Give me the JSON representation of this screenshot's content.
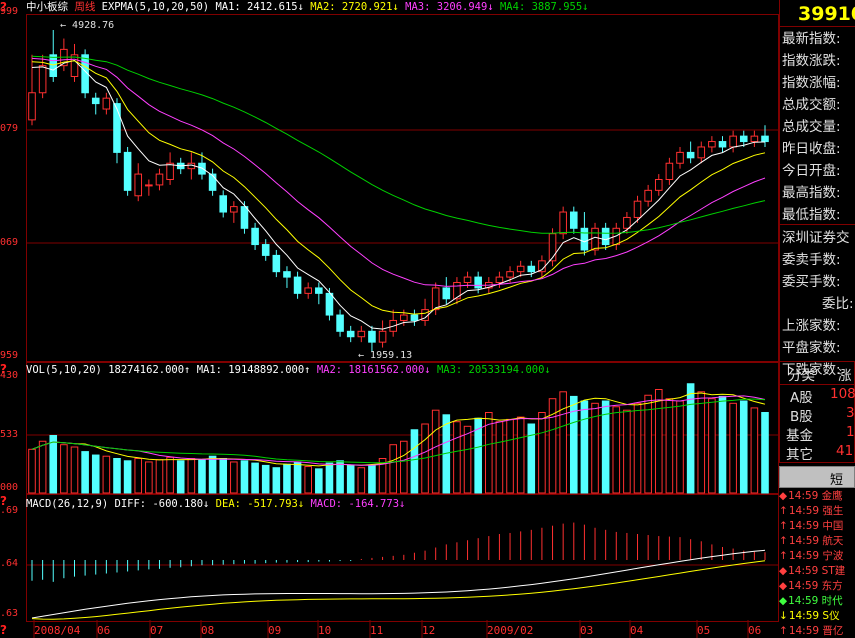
{
  "chart_header": {
    "name": "中小板综",
    "period": "周线",
    "ind": "EXPMA(5,10,20,50)",
    "ma1": "MA1: 2412.615↓",
    "ma2": "MA2: 2720.921↓",
    "ma3": "MA3: 3206.949↓",
    "ma4": "MA4: 3887.955↓"
  },
  "price_axis": [
    "999",
    "079",
    "069",
    "959"
  ],
  "annotations": {
    "high": "4928.76",
    "low": "1959.13"
  },
  "vol_header": {
    "ind": "VOL(5,10,20)",
    "vol": "18274162.000↑",
    "ma1": "MA1: 19148892.000↑",
    "ma2": "MA2: 18161562.000↓",
    "ma3": "MA3: 20533194.000↓"
  },
  "vol_axis": [
    "430",
    "533",
    "000"
  ],
  "macd_header": {
    "ind": "MACD(26,12,9)",
    "diff": "DIFF: -600.180↓",
    "dea": "DEA: -517.793↓",
    "macd": "MACD: -164.773↓"
  },
  "macd_axis": [
    ".69",
    ".64",
    ".63"
  ],
  "x_axis": [
    "2008/04",
    "06",
    "07",
    "08",
    "09",
    "10",
    "11",
    "12",
    "2009/02",
    "03",
    "04",
    "05",
    "06"
  ],
  "right_panel": {
    "code": "39910",
    "fields": [
      "最新指数:",
      "指数涨跌:",
      "指数涨幅:",
      "总成交额:",
      "总成交量:",
      "昨日收盘:",
      "今日开盘:",
      "最高指数:",
      "最低指数:"
    ],
    "market": "深圳证券交",
    "fields2": [
      "委卖手数:",
      "委买手数:",
      "委比:",
      "上涨家数:",
      "平盘家数:",
      "下跌家数:"
    ],
    "table_headers": [
      "分类",
      "涨"
    ],
    "table_rows": [
      {
        "label": "A股",
        "value": "108"
      },
      {
        "label": "B股",
        "value": "3"
      },
      {
        "label": "基金",
        "value": "1"
      },
      {
        "label": "其它",
        "value": "41"
      }
    ],
    "short_line_label": "短线",
    "ticker": [
      {
        "icon": "◆",
        "time": "14:59",
        "name": "金鹰",
        "color": "#ff4040"
      },
      {
        "icon": "↑",
        "time": "14:59",
        "name": "强生",
        "color": "#ff4040"
      },
      {
        "icon": "↑",
        "time": "14:59",
        "name": "中国",
        "color": "#ff4040"
      },
      {
        "icon": "↑",
        "time": "14:59",
        "name": "航天",
        "color": "#ff4040"
      },
      {
        "icon": "↑",
        "time": "14:59",
        "name": "宁波",
        "color": "#ff4040"
      },
      {
        "icon": "◆",
        "time": "14:59",
        "name": "ST建",
        "color": "#ff4040"
      },
      {
        "icon": "◆",
        "time": "14:59",
        "name": "东方",
        "color": "#ff4040"
      },
      {
        "icon": "◆",
        "time": "14:59",
        "name": "时代",
        "color": "#40ff40"
      },
      {
        "icon": "↓",
        "time": "14:59",
        "name": "S仪",
        "color": "#ffff00"
      },
      {
        "icon": "↑",
        "time": "14:59",
        "name": "晋亿",
        "color": "#ff4040"
      }
    ]
  },
  "colors": {
    "up": "#ff3030",
    "down": "#54ffff",
    "ma1": "#ffffff",
    "ma2": "#ffff00",
    "ma3": "#ff40ff",
    "ma4": "#00d000",
    "grid": "#800000"
  },
  "chart_data": {
    "type": "candlestick",
    "price_ylim": [
      1959.13,
      4928.76
    ],
    "candles": [
      [
        4100,
        4350,
        4700,
        4050
      ],
      [
        4350,
        4600,
        4700,
        4300
      ],
      [
        4700,
        4500,
        4928.76,
        4450
      ],
      [
        4600,
        4750,
        4850,
        4550
      ],
      [
        4500,
        4700,
        4800,
        4450
      ],
      [
        4700,
        4350,
        4750,
        4300
      ],
      [
        4300,
        4250,
        4350,
        4150
      ],
      [
        4200,
        4300,
        4350,
        4150
      ],
      [
        4250,
        3800,
        4300,
        3700
      ],
      [
        3800,
        3450,
        3850,
        3400
      ],
      [
        3400,
        3600,
        3700,
        3350
      ],
      [
        3500,
        3500,
        3550,
        3400
      ],
      [
        3500,
        3600,
        3650,
        3450
      ],
      [
        3550,
        3700,
        3800,
        3500
      ],
      [
        3700,
        3650,
        3750,
        3600
      ],
      [
        3650,
        3700,
        3800,
        3550
      ],
      [
        3700,
        3600,
        3800,
        3550
      ],
      [
        3600,
        3450,
        3650,
        3400
      ],
      [
        3400,
        3250,
        3450,
        3200
      ],
      [
        3250,
        3300,
        3350,
        3150
      ],
      [
        3300,
        3100,
        3350,
        3050
      ],
      [
        3100,
        2950,
        3150,
        2900
      ],
      [
        2950,
        2850,
        3000,
        2800
      ],
      [
        2850,
        2700,
        2900,
        2650
      ],
      [
        2700,
        2650,
        2750,
        2550
      ],
      [
        2650,
        2500,
        2700,
        2450
      ],
      [
        2500,
        2550,
        2600,
        2450
      ],
      [
        2550,
        2500,
        2600,
        2400
      ],
      [
        2500,
        2300,
        2550,
        2250
      ],
      [
        2300,
        2150,
        2350,
        2100
      ],
      [
        2150,
        2100,
        2200,
        2050
      ],
      [
        2100,
        2150,
        2200,
        2050
      ],
      [
        2150,
        2050,
        2200,
        1959.13
      ],
      [
        2050,
        2150,
        2250,
        2000
      ],
      [
        2150,
        2250,
        2350,
        2100
      ],
      [
        2250,
        2300,
        2350,
        2200
      ],
      [
        2300,
        2250,
        2350,
        2200
      ],
      [
        2250,
        2350,
        2450,
        2200
      ],
      [
        2350,
        2550,
        2600,
        2300
      ],
      [
        2550,
        2450,
        2650,
        2400
      ],
      [
        2450,
        2600,
        2650,
        2400
      ],
      [
        2600,
        2650,
        2700,
        2550
      ],
      [
        2650,
        2550,
        2700,
        2500
      ],
      [
        2550,
        2600,
        2650,
        2500
      ],
      [
        2600,
        2650,
        2700,
        2550
      ],
      [
        2650,
        2700,
        2750,
        2600
      ],
      [
        2700,
        2750,
        2800,
        2650
      ],
      [
        2750,
        2700,
        2800,
        2650
      ],
      [
        2700,
        2800,
        2850,
        2650
      ],
      [
        2800,
        3050,
        3100,
        2750
      ],
      [
        3050,
        3250,
        3300,
        3000
      ],
      [
        3250,
        3100,
        3300,
        3050
      ],
      [
        3100,
        2900,
        3250,
        2850
      ],
      [
        2900,
        3100,
        3150,
        2850
      ],
      [
        3100,
        2950,
        3150,
        2900
      ],
      [
        2950,
        3100,
        3150,
        2900
      ],
      [
        3100,
        3200,
        3250,
        3050
      ],
      [
        3200,
        3350,
        3400,
        3150
      ],
      [
        3350,
        3450,
        3500,
        3300
      ],
      [
        3450,
        3550,
        3600,
        3400
      ],
      [
        3550,
        3700,
        3750,
        3500
      ],
      [
        3700,
        3800,
        3850,
        3650
      ],
      [
        3800,
        3750,
        3900,
        3700
      ],
      [
        3750,
        3850,
        3900,
        3700
      ],
      [
        3850,
        3900,
        3950,
        3800
      ],
      [
        3900,
        3850,
        3950,
        3800
      ],
      [
        3850,
        3950,
        4000,
        3800
      ],
      [
        3950,
        3900,
        4000,
        3850
      ],
      [
        3900,
        3950,
        4000,
        3850
      ],
      [
        3950,
        3900,
        4050,
        3850
      ]
    ],
    "volume": [
      0.38,
      0.45,
      0.5,
      0.42,
      0.4,
      0.36,
      0.33,
      0.32,
      0.3,
      0.28,
      0.3,
      0.27,
      0.29,
      0.31,
      0.28,
      0.3,
      0.29,
      0.32,
      0.3,
      0.27,
      0.28,
      0.26,
      0.24,
      0.22,
      0.25,
      0.27,
      0.23,
      0.21,
      0.26,
      0.28,
      0.24,
      0.22,
      0.24,
      0.3,
      0.42,
      0.45,
      0.55,
      0.6,
      0.72,
      0.68,
      0.62,
      0.58,
      0.65,
      0.7,
      0.62,
      0.64,
      0.66,
      0.6,
      0.7,
      0.82,
      0.88,
      0.84,
      0.8,
      0.78,
      0.8,
      0.75,
      0.72,
      0.78,
      0.85,
      0.9,
      0.82,
      0.8,
      0.95,
      0.88,
      0.82,
      0.84,
      0.78,
      0.8,
      0.74,
      0.7
    ],
    "macd_bars": [
      -0.4,
      -0.38,
      -0.42,
      -0.35,
      -0.32,
      -0.3,
      -0.28,
      -0.26,
      -0.24,
      -0.22,
      -0.2,
      -0.18,
      -0.17,
      -0.15,
      -0.14,
      -0.12,
      -0.1,
      -0.1,
      -0.09,
      -0.08,
      -0.07,
      -0.07,
      -0.06,
      -0.05,
      -0.05,
      -0.04,
      -0.04,
      -0.03,
      -0.03,
      -0.02,
      -0.02,
      0.02,
      0.04,
      0.06,
      0.08,
      0.1,
      0.14,
      0.18,
      0.24,
      0.3,
      0.34,
      0.38,
      0.42,
      0.46,
      0.5,
      0.52,
      0.55,
      0.58,
      0.62,
      0.66,
      0.7,
      0.72,
      0.68,
      0.62,
      0.58,
      0.54,
      0.52,
      0.5,
      0.48,
      0.46,
      0.45,
      0.44,
      0.4,
      0.36,
      0.3,
      0.25,
      0.22,
      0.18,
      0.16,
      0.15
    ]
  }
}
